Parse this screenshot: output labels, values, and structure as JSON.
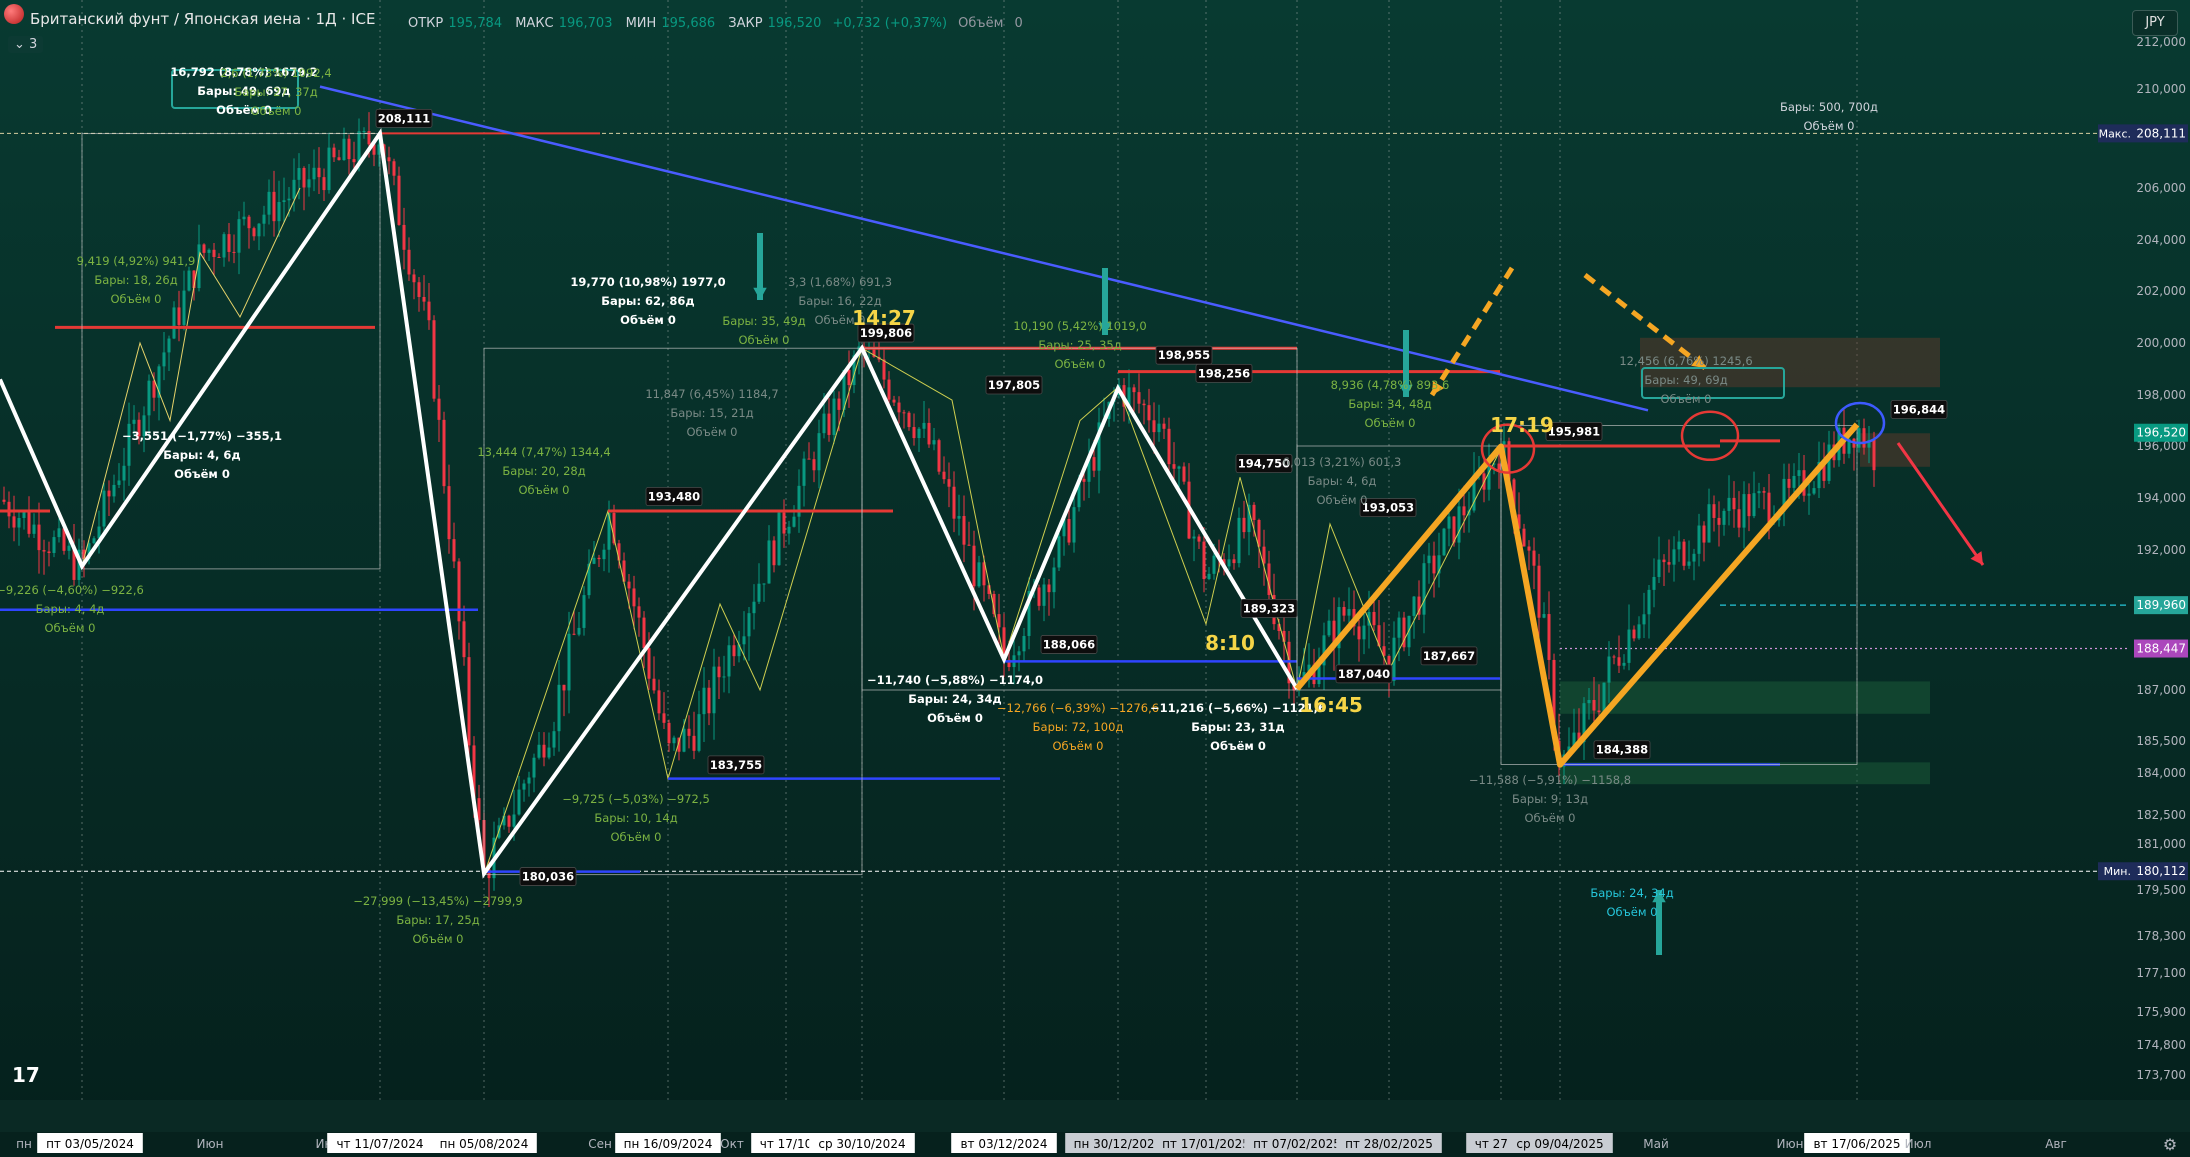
{
  "header": {
    "title": "Британский фунт / Японская иена · 1Д · ICE",
    "open_label": "ОТКР",
    "open": "195,784",
    "high_label": "МАКС",
    "high": "196,703",
    "low_label": "МИН",
    "low": "195,686",
    "close_label": "ЗАКР",
    "close": "196,520",
    "change": "+0,732 (+0,37%)",
    "volume_label": "Объём",
    "volume": "0",
    "indicators_count": "3",
    "currency": "JPY"
  },
  "colors": {
    "background": "#062a24",
    "up": "#089981",
    "down": "#f23645",
    "zigzag_white": "#ffffff",
    "zigzag_orange": "#f5a623",
    "trend_blue": "#4a5cff",
    "level_red": "#e53935",
    "level_blue": "#2f45ff",
    "arrow_teal": "#26a69a",
    "arrow_orange_dashed": "#f5a623",
    "arrow_red": "#f23645"
  },
  "chart_data": {
    "type": "line",
    "symbol": "GBPJPY",
    "timeframe": "1Д",
    "ylim": [
      172.6,
      212.5
    ],
    "y_ticks": [
      "212,000",
      "210,000",
      "208,000",
      "206,000",
      "204,000",
      "202,000",
      "200,000",
      "198,000",
      "196,000",
      "194,000",
      "192,000",
      "190,000",
      "187,000",
      "185,500",
      "184,000",
      "182,500",
      "181,000",
      "179,500",
      "178,300",
      "177,100",
      "175,900",
      "174,800",
      "173,700"
    ],
    "y_tick_values": [
      212.0,
      210.0,
      208.0,
      206.0,
      204.0,
      202.0,
      200.0,
      198.0,
      196.0,
      194.0,
      192.0,
      190.0,
      187.0,
      185.5,
      184.0,
      182.5,
      181.0,
      179.5,
      178.3,
      177.1,
      175.9,
      174.8,
      173.7
    ],
    "price_labels": [
      {
        "text": "208,111",
        "value": 208.111,
        "tag": "Макс.",
        "color": "#1e2c5a"
      },
      {
        "text": "196,520",
        "value": 196.52,
        "tag": "",
        "color": "#089981"
      },
      {
        "text": "189,960",
        "value": 189.96,
        "tag": "",
        "color": "#26a69a"
      },
      {
        "text": "188,447",
        "value": 188.447,
        "tag": "",
        "color": "#ab47bc"
      },
      {
        "text": "180,112",
        "value": 180.112,
        "tag": "Мин.",
        "color": "#1e2c5a"
      }
    ],
    "x_labels": [
      "пн",
      "пт 03/05/2024",
      "Июн",
      "Ию",
      "чт 11/07/2024",
      "пн 05/08/2024",
      "Сен",
      "пн 16/09/2024",
      "Окт",
      "чт 17/10",
      "ср 30/10/2024",
      "вт 03/12/2024",
      "пн 30/12/2024",
      "пт 17/01/2025",
      "пт 07/02/2025",
      "пт 28/02/2025",
      "чт 27/03",
      "ср 09/04/2025",
      "Май",
      "Июн",
      "вт 17/06/2025",
      "Июл",
      "Авг"
    ],
    "zigzag_white": {
      "x": [
        "пт 03/05/2024",
        "2024-06-05",
        "чт 11/07/2024",
        "пн 05/08/2024",
        "ср 30/10/2024",
        "вт 03/12/2024",
        "пн 30/12/2024",
        "пт 07/02/2025"
      ],
      "y": [
        210.0,
        191.4,
        208.111,
        180.036,
        199.806,
        188.066,
        198.256,
        187.04
      ]
    },
    "zigzag_orange": {
      "x": [
        "пт 07/02/2025",
        "чт 27/03",
        "ср 09/04/2025",
        "вт 17/06/2025"
      ],
      "y": [
        187.04,
        195.981,
        184.388,
        196.844
      ]
    },
    "pivot_labels": [
      "208,111",
      "199,806",
      "198,955",
      "198,256",
      "197,805",
      "196,844",
      "195,981",
      "194,750",
      "193,480",
      "193,053",
      "189,323",
      "188,066",
      "187,667",
      "187,040",
      "184,388",
      "183,755",
      "180,036"
    ],
    "pivot_values": [
      208.111,
      199.806,
      198.955,
      198.256,
      197.805,
      196.844,
      195.981,
      194.75,
      193.48,
      193.053,
      189.323,
      188.066,
      187.667,
      187.04,
      184.388,
      183.755,
      180.036
    ],
    "measure_labels": [
      {
        "line1": "16,792 (8,78%) 1679,2",
        "line2": "Бары: 49, 69д",
        "line3": "Объём 0",
        "color": "#ffffff"
      },
      {
        "line1": "9,419 (4,92%) 941,9",
        "line2": "Бары: 18, 26д",
        "line3": "Объём 0",
        "color": "#7cb342"
      },
      {
        "line1": "19,770 (10,98%) 1977,0",
        "line2": "Бары: 62, 86д",
        "line3": "Объём 0",
        "color": "#ffffff"
      },
      {
        "line1": "−3,551 (−1,77%) −355,1",
        "line2": "Бары: 4, 6д",
        "line3": "Объём 0",
        "color": "#ffffff"
      },
      {
        "line1": "13,444 (7,47%) 1344,4",
        "line2": "Бары: 20, 28д",
        "line3": "Объём 0",
        "color": "#7cb342"
      },
      {
        "line1": "11,847 (6,45%) 1184,7",
        "line2": "Бары: 15, 21д",
        "line3": "Объём 0",
        "color": "#7a8a86"
      },
      {
        "line1": "−9,226 (−4,60%) −922,6",
        "line2": "Бары: 4, 4д",
        "line3": "Объём 0",
        "color": "#7cb342"
      },
      {
        "line1": "−27,999 (−13,45%) −2799,9",
        "line2": "Бары: 17, 25д",
        "line3": "Объём 0",
        "color": "#7cb342"
      },
      {
        "line1": "−9,725 (−5,03%) −972,5",
        "line2": "Бары: 10, 14д",
        "line3": "Объём 0",
        "color": "#7cb342"
      },
      {
        "line1": "−11,740 (−5,88%) −1174,0",
        "line2": "Бары: 24, 34д",
        "line3": "Объём 0",
        "color": "#ffffff"
      },
      {
        "line1": "−12,766 (−6,39%) −1276,6",
        "line2": "Бары: 72, 100д",
        "line3": "Объём 0",
        "color": "#f5a623"
      },
      {
        "line1": "−11,216 (−5,66%) −1121,6",
        "line2": "Бары: 23, 31д",
        "line3": "Объём 0",
        "color": "#ffffff"
      },
      {
        "line1": "10,190 (5,42%) 1019,0",
        "line2": "Бары: 25, 35д",
        "line3": "Объём 0",
        "color": "#7cb342"
      },
      {
        "line1": "8,936 (4,78%) 893,6",
        "line2": "Бары: 34, 48д",
        "line3": "Объём 0",
        "color": "#7cb342"
      },
      {
        "line1": "6,013 (3,21%) 601,3",
        "line2": "Бары: 4, 6д",
        "line3": "Объём 0",
        "color": "#7a8a86"
      },
      {
        "line1": "−11,588 (−5,91%) −1158,8",
        "line2": "Бары: 9, 13д",
        "line3": "Объём 0",
        "color": "#7a8a86"
      },
      {
        "line1": "12,456 (6,76%) 1245,6",
        "line2": "Бары: 49, 69д",
        "line3": "Объём 0",
        "color": "#7a8a86"
      },
      {
        "line1": "",
        "line2": "Бары: 500, 700д",
        "line3": "Объём 0",
        "color": "#d1d4dc"
      },
      {
        "line1": "",
        "line2": "Бары: 24, 34д",
        "line3": "Объём 0",
        "color": "#26c6da"
      },
      {
        "line1": "3,3 (1,68%) 691,3",
        "line2": "Бары: 16, 22д",
        "line3": "Объём 0",
        "color": "#7a8a86"
      },
      {
        "line1": "2,6 (1,73%) 1092,4",
        "line2": "Бары: 27, 37д",
        "line3": "Объём 0",
        "color": "#7cb342"
      },
      {
        "line1": "",
        "line2": "Бары: 35, 49д",
        "line3": "Объём 0",
        "color": "#7cb342"
      }
    ],
    "time_annotations": [
      "14:27",
      "8:10",
      "16:45",
      "17:19"
    ],
    "grid": false,
    "legend": "none"
  }
}
